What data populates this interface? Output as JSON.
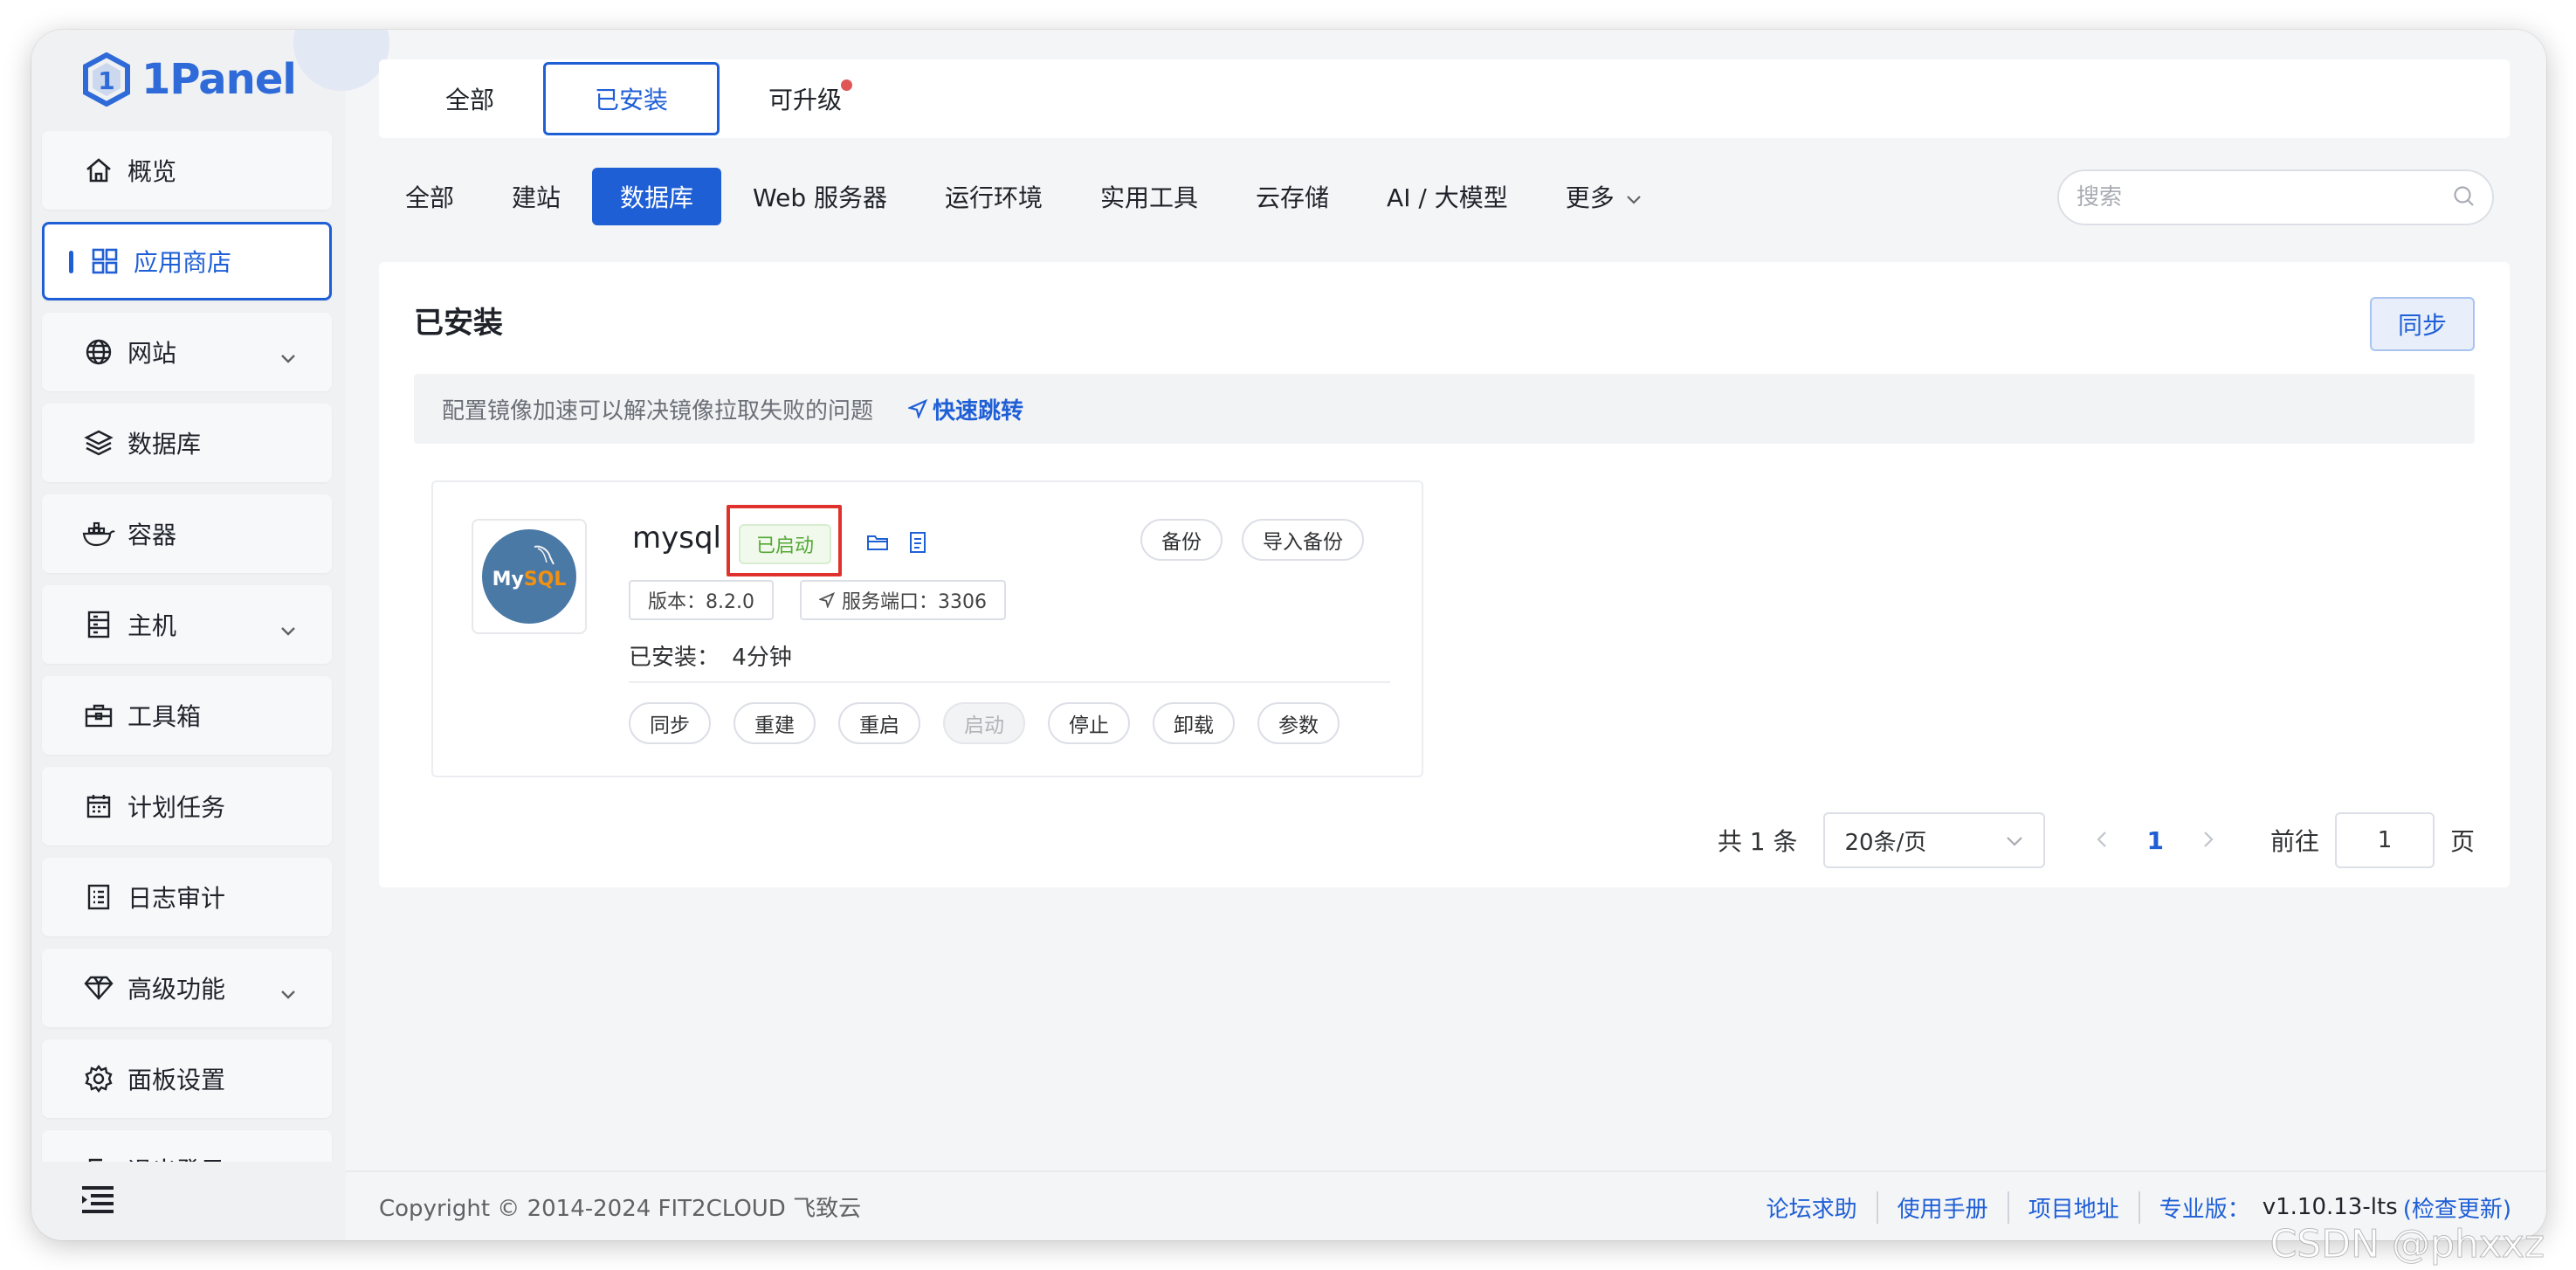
{
  "brand": {
    "name": "1Panel"
  },
  "sidebar": {
    "items": [
      {
        "label": "概览",
        "icon": "home-icon"
      },
      {
        "label": "应用商店",
        "icon": "apps-grid-icon",
        "active": true
      },
      {
        "label": "网站",
        "icon": "globe-icon",
        "expandable": true
      },
      {
        "label": "数据库",
        "icon": "layers-icon"
      },
      {
        "label": "容器",
        "icon": "docker-icon"
      },
      {
        "label": "主机",
        "icon": "server-icon",
        "expandable": true
      },
      {
        "label": "工具箱",
        "icon": "toolbox-icon"
      },
      {
        "label": "计划任务",
        "icon": "calendar-icon"
      },
      {
        "label": "日志审计",
        "icon": "log-icon"
      },
      {
        "label": "高级功能",
        "icon": "diamond-icon",
        "expandable": true
      },
      {
        "label": "面板设置",
        "icon": "gear-icon"
      },
      {
        "label": "退出登录",
        "icon": "logout-icon"
      }
    ]
  },
  "top_tabs": [
    {
      "label": "全部"
    },
    {
      "label": "已安装",
      "active": true
    },
    {
      "label": "可升级",
      "badge_dot": true
    }
  ],
  "categories": [
    {
      "label": "全部"
    },
    {
      "label": "建站"
    },
    {
      "label": "数据库",
      "active": true
    },
    {
      "label": "Web 服务器"
    },
    {
      "label": "运行环境"
    },
    {
      "label": "实用工具"
    },
    {
      "label": "云存储"
    },
    {
      "label": "AI / 大模型"
    },
    {
      "label": "更多"
    }
  ],
  "search": {
    "placeholder": "搜索"
  },
  "panel": {
    "title": "已安装",
    "sync_label": "同步",
    "notice_text": "配置镜像加速可以解决镜像拉取失败的问题",
    "notice_link": "快速跳转"
  },
  "app": {
    "name": "mysql",
    "logo_text": "MySQL",
    "status": "已启动",
    "backup_label": "备份",
    "import_backup_label": "导入备份",
    "version_tag": "版本：8.2.0",
    "port_tag": "服务端口：3306",
    "installed_label": "已安装：",
    "installed_time": "4分钟",
    "actions": [
      {
        "label": "同步"
      },
      {
        "label": "重建"
      },
      {
        "label": "重启"
      },
      {
        "label": "启动",
        "disabled": true
      },
      {
        "label": "停止"
      },
      {
        "label": "卸载"
      },
      {
        "label": "参数"
      }
    ]
  },
  "pagination": {
    "total": "共 1 条",
    "page_size": "20条/页",
    "current_page": "1",
    "goto_label": "前往",
    "goto_value": "1",
    "page_suffix": "页"
  },
  "footer": {
    "copyright": "Copyright © 2014-2024 FIT2CLOUD 飞致云",
    "links": [
      "论坛求助",
      "使用手册",
      "项目地址"
    ],
    "edition_label": "专业版：",
    "version": "v1.10.13-lts",
    "check_update": "(检查更新)"
  },
  "watermark": "CSDN @phxxz",
  "colors": {
    "accent": "#1f5fd6",
    "running_green": "#53a835",
    "highlight_red": "#e0322c"
  }
}
